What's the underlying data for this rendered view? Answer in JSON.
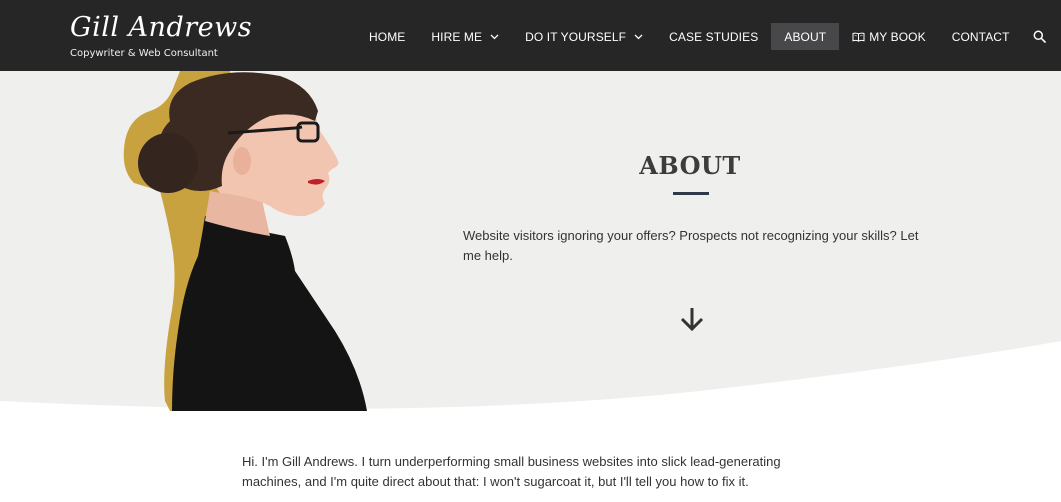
{
  "header": {
    "logo_text": "Gill Andrews",
    "tagline": "Copywriter & Web Consultant"
  },
  "nav": {
    "items": [
      {
        "label": "HOME"
      },
      {
        "label": "HIRE ME",
        "dropdown": true
      },
      {
        "label": "DO IT YOURSELF",
        "dropdown": true
      },
      {
        "label": "CASE STUDIES"
      },
      {
        "label": "ABOUT",
        "active": true
      },
      {
        "label": "MY BOOK",
        "icon": "book-icon"
      },
      {
        "label": "CONTACT"
      }
    ],
    "search_icon": "search-icon"
  },
  "hero": {
    "title": "ABOUT",
    "lead": "Website visitors ignoring your offers? Prospects not recognizing your skills? Let me help.",
    "scroll_icon": "arrow-down-icon"
  },
  "intro": {
    "text": "Hi. I'm Gill Andrews. I turn underperforming small business websites into slick lead-generating machines, and I'm quite direct about that: I won't sugarcoat it, but I'll tell you how to fix it."
  },
  "colors": {
    "header_bg": "#262626",
    "hero_bg": "#efefed",
    "accent_gold": "#c9a240",
    "title_rule": "#2e3a4a"
  }
}
